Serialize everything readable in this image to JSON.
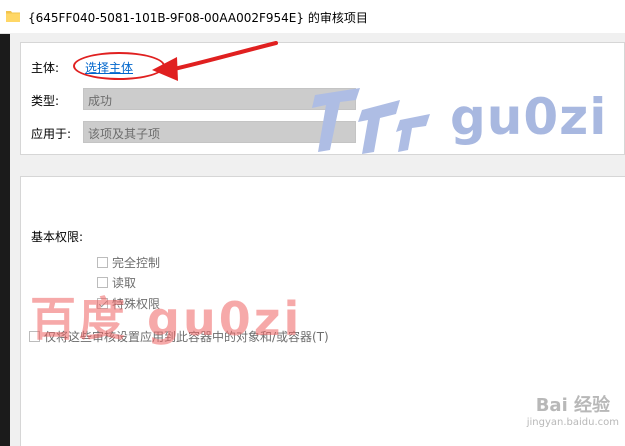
{
  "window": {
    "title": "{645FF040-5081-101B-9F08-00AA002F954E} 的审核项目"
  },
  "principal": {
    "label": "主体:",
    "link_text": "选择主体"
  },
  "type": {
    "label": "类型:",
    "value": "成功"
  },
  "applies_to": {
    "label": "应用于:",
    "value": "该项及其子项"
  },
  "permissions": {
    "section_label": "基本权限:",
    "items": [
      {
        "label": "完全控制",
        "checked": false
      },
      {
        "label": "读取",
        "checked": false
      },
      {
        "label": "特殊权限",
        "checked": true
      }
    ]
  },
  "apply_option": {
    "label": "仅将这些审核设置应用到此容器中的对象和/或容器(T)",
    "checked": false
  },
  "watermarks": {
    "logo_text": "gu0zi",
    "red_text": "百度 gu0zi",
    "corner_brand": "Bai 经验",
    "corner_url": "jingyan.baidu.com"
  },
  "colors": {
    "link": "#0066cc",
    "annotation_red": "#e02020"
  }
}
